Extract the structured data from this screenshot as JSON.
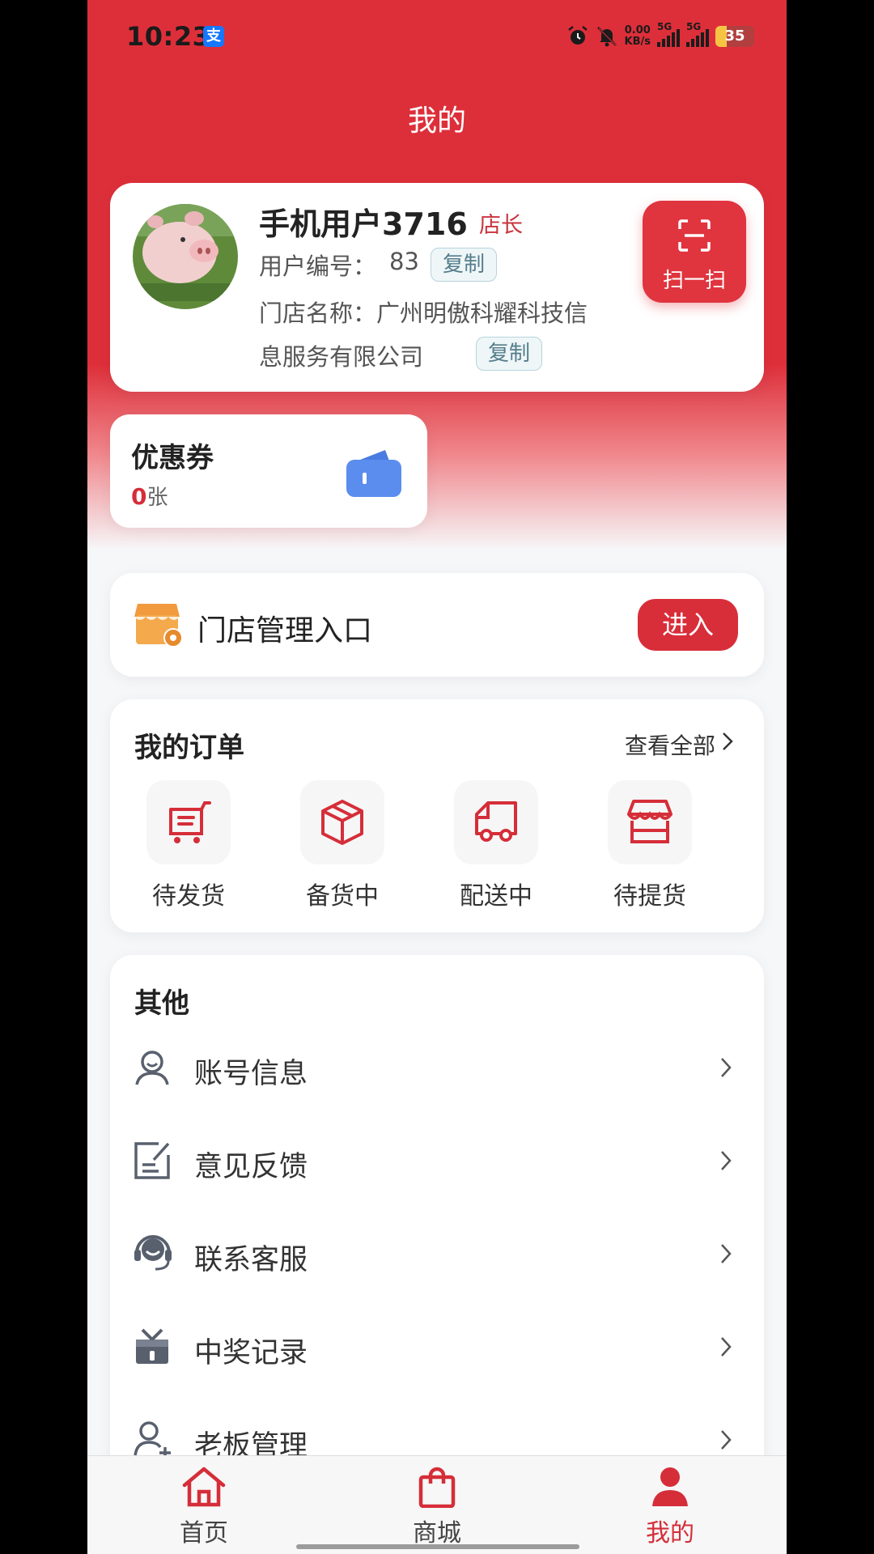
{
  "status_bar": {
    "time": "10:23",
    "alipay_badge": "支",
    "net_speed_value": "0.00",
    "net_speed_unit": "KB/s",
    "sim1": "5G",
    "sim2": "5G",
    "battery": "35"
  },
  "header": {
    "title": "我的"
  },
  "profile": {
    "username": "手机用户3716",
    "role": "店长",
    "user_id_label": "用户编号：",
    "user_id": "83",
    "copy_label": "复制",
    "store_name_line1": "门店名称：广州明傲科耀科技信",
    "store_name_line2": "息服务有限公司",
    "scan_label": "扫一扫"
  },
  "coupon": {
    "title": "优惠券",
    "count": "0",
    "unit": "张"
  },
  "store_entry": {
    "label": "门店管理入口",
    "button": "进入"
  },
  "orders": {
    "title": "我的订单",
    "view_all": "查看全部",
    "items": [
      {
        "label": "待发货",
        "icon": "cart-icon"
      },
      {
        "label": "备货中",
        "icon": "box-icon"
      },
      {
        "label": "配送中",
        "icon": "truck-icon"
      },
      {
        "label": "待提货",
        "icon": "store-icon"
      }
    ]
  },
  "others": {
    "title": "其他",
    "items": [
      {
        "label": "账号信息",
        "icon": "user-icon"
      },
      {
        "label": "意见反馈",
        "icon": "feedback-icon"
      },
      {
        "label": "联系客服",
        "icon": "headset-icon"
      },
      {
        "label": "中奖记录",
        "icon": "gift-icon"
      },
      {
        "label": "老板管理",
        "icon": "user-add-icon"
      }
    ]
  },
  "tabbar": {
    "items": [
      {
        "label": "首页",
        "icon": "home-icon",
        "active": false
      },
      {
        "label": "商城",
        "icon": "shopping-bag-icon",
        "active": false
      },
      {
        "label": "我的",
        "icon": "person-icon",
        "active": true
      }
    ]
  },
  "colors": {
    "brand_red": "#dd2f3a",
    "accent_red": "#d52e39",
    "coupon_icon_blue": "#5b8def",
    "store_icon_orange": "#f19a3e"
  }
}
